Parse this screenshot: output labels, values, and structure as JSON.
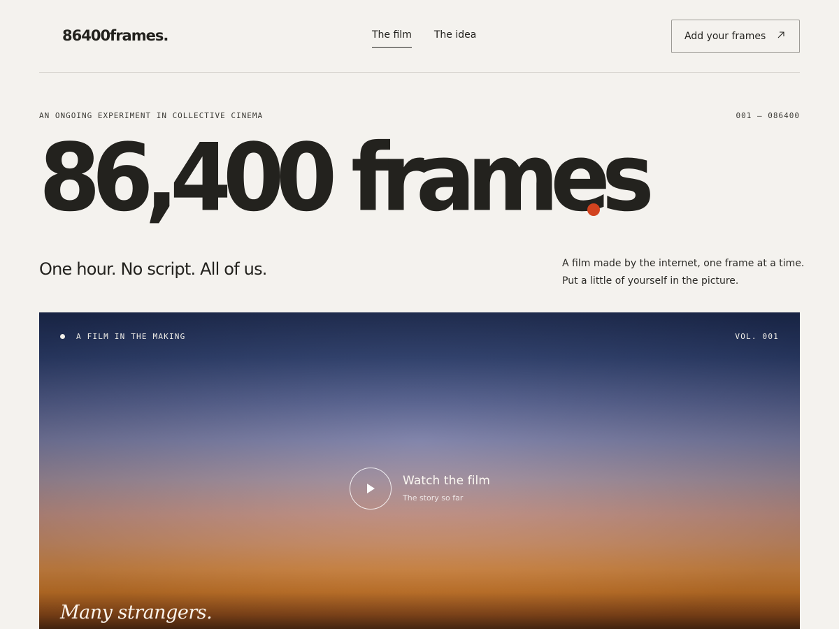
{
  "header": {
    "logo": "86400frames.",
    "nav": [
      {
        "label": "The film",
        "active": true
      },
      {
        "label": "The idea",
        "active": false
      }
    ],
    "cta_label": "Add your frames",
    "cta_icon": "arrow-up-right-icon"
  },
  "meta": {
    "eyebrow": "AN ONGOING EXPERIMENT IN COLLECTIVE CINEMA",
    "range": "001 — 086400"
  },
  "hero": {
    "title": "86,400 frames",
    "accent_color": "#d2431f",
    "tagline": "One hour. No script. All of us.",
    "blurb_line1": "A film made by the internet, one frame at a time.",
    "blurb_line2": "Put a little of yourself in the picture."
  },
  "film": {
    "label": "A FILM IN THE MAKING",
    "volume": "VOL. 001",
    "watch_title": "Watch the film",
    "watch_subtitle": "The story so far",
    "caption": "Many strangers."
  }
}
